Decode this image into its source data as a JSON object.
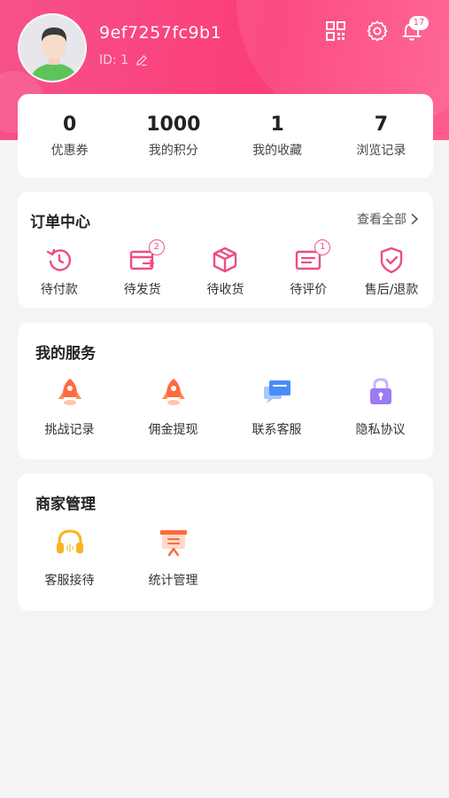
{
  "profile": {
    "username": "9ef7257fc9b1",
    "id_label": "ID: 1",
    "notification_count": "17"
  },
  "stats": [
    {
      "value": "0",
      "label": "优惠券"
    },
    {
      "value": "1000",
      "label": "我的积分"
    },
    {
      "value": "1",
      "label": "我的收藏"
    },
    {
      "value": "7",
      "label": "浏览记录"
    }
  ],
  "orders": {
    "title": "订单中心",
    "view_all": "查看全部",
    "items": [
      {
        "label": "待付款",
        "icon": "clock-icon"
      },
      {
        "label": "待发货",
        "icon": "card-ship-icon",
        "badge": "2"
      },
      {
        "label": "待收货",
        "icon": "box-icon"
      },
      {
        "label": "待评价",
        "icon": "review-icon",
        "badge": "1"
      },
      {
        "label": "售后/退款",
        "icon": "shield-icon"
      }
    ]
  },
  "services": {
    "title": "我的服务",
    "items": [
      {
        "label": "挑战记录",
        "icon": "rocket-icon"
      },
      {
        "label": "佣金提现",
        "icon": "rocket-icon"
      },
      {
        "label": "联系客服",
        "icon": "chat-icon"
      },
      {
        "label": "隐私协议",
        "icon": "lock-icon"
      }
    ]
  },
  "merchant": {
    "title": "商家管理",
    "items": [
      {
        "label": "客服接待",
        "icon": "headset-icon"
      },
      {
        "label": "统计管理",
        "icon": "presentation-icon"
      }
    ]
  },
  "colors": {
    "brand": "#f7518a",
    "accent_orange": "#ff6a3c",
    "accent_blue": "#4a8cf7",
    "accent_purple": "#9b7bf2",
    "accent_yellow": "#f9b321"
  }
}
